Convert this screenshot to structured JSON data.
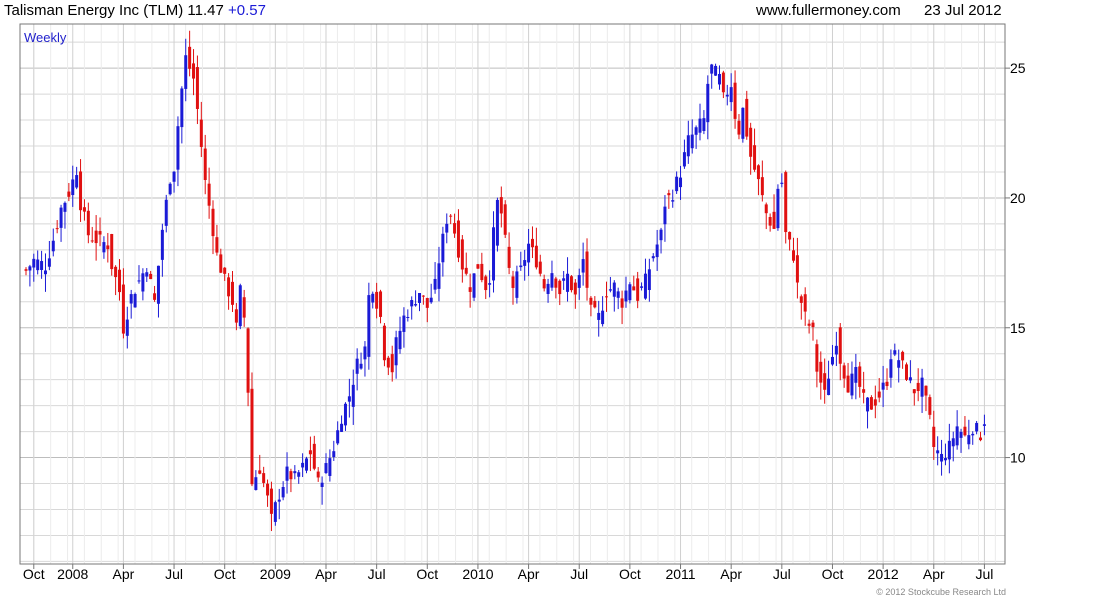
{
  "header": {
    "title_main": "Talisman Energy Inc (TLM) 11.47",
    "title_change": "+0.57",
    "website": "www.fullermoney.com",
    "date": "23 Jul 2012"
  },
  "footer": {
    "copyright": "© 2012 Stockcube Research Ltd"
  },
  "colors": {
    "up": "#1a1ad6",
    "down": "#e01010",
    "grid": "#d8d8d8",
    "change_text": "#1a1ad6"
  },
  "chart_data": {
    "type": "candlestick",
    "interval_label": "Weekly",
    "title": "Talisman Energy Inc (TLM) 11.47 +0.57",
    "y_axis_side": "right",
    "ylim": [
      5.9,
      26.7
    ],
    "yticks": [
      10,
      15,
      20,
      25
    ],
    "x_tick_labels": [
      "Oct",
      "2008",
      "Apr",
      "Jul",
      "Oct",
      "2009",
      "Apr",
      "Jul",
      "Oct",
      "2010",
      "Apr",
      "Jul",
      "Oct",
      "2011",
      "Apr",
      "Jul",
      "Oct",
      "2012",
      "Apr",
      "Jul"
    ],
    "grid": true,
    "x_range_weeks": [
      0,
      250
    ],
    "anchor_closes": [
      [
        0,
        17.2
      ],
      [
        2,
        17.6
      ],
      [
        5,
        17.4
      ],
      [
        7,
        18.4
      ],
      [
        9,
        19.6
      ],
      [
        11,
        20.2
      ],
      [
        13,
        21.1
      ],
      [
        14,
        19.8
      ],
      [
        16,
        18.6
      ],
      [
        18,
        18.4
      ],
      [
        21,
        18.2
      ],
      [
        22,
        17.4
      ],
      [
        24,
        16.4
      ],
      [
        25,
        15.0
      ],
      [
        27,
        16.2
      ],
      [
        29,
        16.8
      ],
      [
        31,
        17.4
      ],
      [
        33,
        16.0
      ],
      [
        35,
        18.8
      ],
      [
        37,
        20.8
      ],
      [
        38,
        21.2
      ],
      [
        39,
        22.8
      ],
      [
        40,
        24.2
      ],
      [
        41,
        25.4
      ],
      [
        43,
        24.6
      ],
      [
        44,
        23.4
      ],
      [
        45,
        22.0
      ],
      [
        46,
        20.6
      ],
      [
        48,
        18.8
      ],
      [
        49,
        17.8
      ],
      [
        51,
        16.8
      ],
      [
        53,
        16.0
      ],
      [
        54,
        15.0
      ],
      [
        55,
        16.4
      ],
      [
        56,
        15.4
      ],
      [
        57,
        12.6
      ],
      [
        58,
        9.0
      ],
      [
        60,
        9.6
      ],
      [
        62,
        8.4
      ],
      [
        63,
        7.6
      ],
      [
        65,
        8.6
      ],
      [
        67,
        9.4
      ],
      [
        69,
        9.2
      ],
      [
        71,
        9.6
      ],
      [
        73,
        10.2
      ],
      [
        75,
        9.0
      ],
      [
        77,
        9.6
      ],
      [
        79,
        10.4
      ],
      [
        81,
        11.6
      ],
      [
        83,
        12.4
      ],
      [
        85,
        13.6
      ],
      [
        87,
        14.2
      ],
      [
        88,
        16.2
      ],
      [
        89,
        16.6
      ],
      [
        91,
        15.4
      ],
      [
        92,
        14.0
      ],
      [
        94,
        13.4
      ],
      [
        95,
        14.4
      ],
      [
        97,
        15.4
      ],
      [
        99,
        15.9
      ],
      [
        101,
        16.4
      ],
      [
        103,
        15.8
      ],
      [
        105,
        16.6
      ],
      [
        106,
        17.6
      ],
      [
        108,
        19.2
      ],
      [
        109,
        19.4
      ],
      [
        111,
        18.0
      ],
      [
        112,
        17.4
      ],
      [
        114,
        16.6
      ],
      [
        116,
        17.4
      ],
      [
        118,
        16.6
      ],
      [
        119,
        17.0
      ],
      [
        120,
        18.6
      ],
      [
        121,
        19.8
      ],
      [
        122,
        19.4
      ],
      [
        124,
        17.2
      ],
      [
        125,
        16.6
      ],
      [
        127,
        17.2
      ],
      [
        129,
        18.2
      ],
      [
        131,
        17.6
      ],
      [
        133,
        16.6
      ],
      [
        135,
        17.2
      ],
      [
        137,
        16.4
      ],
      [
        139,
        17.0
      ],
      [
        141,
        16.2
      ],
      [
        143,
        17.6
      ],
      [
        145,
        15.6
      ],
      [
        147,
        15.4
      ],
      [
        149,
        16.4
      ],
      [
        151,
        16.6
      ],
      [
        153,
        16.0
      ],
      [
        155,
        16.8
      ],
      [
        157,
        16.2
      ],
      [
        159,
        16.8
      ],
      [
        161,
        17.8
      ],
      [
        163,
        18.6
      ],
      [
        164,
        19.8
      ],
      [
        166,
        20.2
      ],
      [
        168,
        21.0
      ],
      [
        170,
        22.2
      ],
      [
        172,
        22.6
      ],
      [
        174,
        23.0
      ],
      [
        175,
        24.4
      ],
      [
        176,
        25.0
      ],
      [
        178,
        24.6
      ],
      [
        179,
        23.8
      ],
      [
        181,
        24.4
      ],
      [
        182,
        23.2
      ],
      [
        183,
        22.6
      ],
      [
        184,
        23.4
      ],
      [
        186,
        21.6
      ],
      [
        188,
        20.6
      ],
      [
        190,
        19.4
      ],
      [
        192,
        18.8
      ],
      [
        193,
        20.4
      ],
      [
        194,
        20.6
      ],
      [
        195,
        18.6
      ],
      [
        197,
        17.8
      ],
      [
        198,
        16.6
      ],
      [
        200,
        15.4
      ],
      [
        202,
        14.8
      ],
      [
        203,
        13.4
      ],
      [
        205,
        12.4
      ],
      [
        206,
        13.2
      ],
      [
        208,
        14.6
      ],
      [
        209,
        13.8
      ],
      [
        211,
        12.8
      ],
      [
        213,
        13.2
      ],
      [
        215,
        12.2
      ],
      [
        217,
        12.0
      ],
      [
        219,
        12.4
      ],
      [
        221,
        13.0
      ],
      [
        222,
        14.0
      ],
      [
        224,
        13.8
      ],
      [
        226,
        13.2
      ],
      [
        228,
        12.6
      ],
      [
        230,
        12.8
      ],
      [
        232,
        11.4
      ],
      [
        233,
        10.4
      ],
      [
        235,
        10.0
      ],
      [
        237,
        10.4
      ],
      [
        239,
        11.2
      ],
      [
        241,
        10.8
      ],
      [
        243,
        11.2
      ],
      [
        245,
        10.9
      ],
      [
        246,
        11.47
      ]
    ]
  }
}
